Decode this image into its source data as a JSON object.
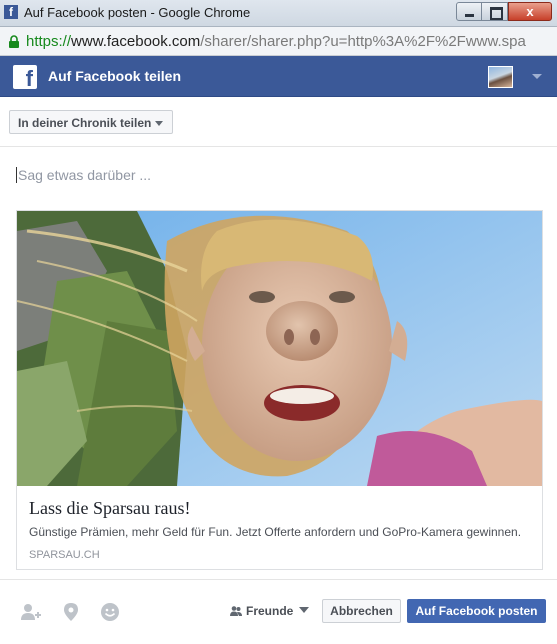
{
  "window": {
    "title": "Auf Facebook posten - Google Chrome",
    "close_label": "x"
  },
  "browser": {
    "url_scheme": "https://",
    "url_host": "www.facebook.com",
    "url_path": "/sharer/sharer.php?u=http%3A%2F%2Fwww.spa"
  },
  "header": {
    "logo_text": "f",
    "title": "Auf Facebook teilen"
  },
  "share": {
    "target_label": "In deiner Chronik teilen"
  },
  "composer": {
    "value": "",
    "placeholder": "Sag etwas darüber ..."
  },
  "preview": {
    "title": "Lass die Sparsau raus!",
    "description": "Günstige Prämien, mehr Geld für Fun. Jetzt Offerte anfordern und GoPro-Kamera gewinnen.",
    "domain": "SPARSAU.CH"
  },
  "footer": {
    "audience_label": "Freunde",
    "cancel_label": "Abbrechen",
    "post_label": "Auf Facebook posten"
  },
  "icons": {
    "tag_friends": "add-person-icon",
    "location": "location-pin-icon",
    "feeling": "smiley-icon"
  },
  "colors": {
    "brand": "#3b5998",
    "post_button": "#4267b2",
    "secure_url": "#17891d"
  }
}
